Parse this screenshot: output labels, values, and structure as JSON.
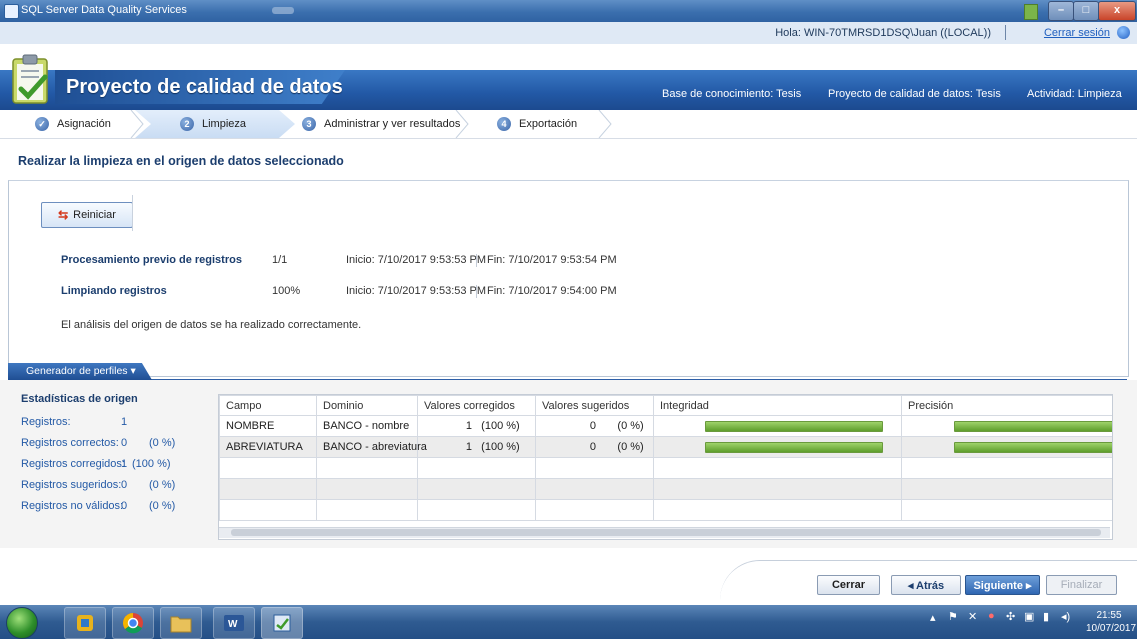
{
  "window": {
    "title": "SQL Server Data Quality Services",
    "min_glyph": "–",
    "max_glyph": "□",
    "close_glyph": "x"
  },
  "userbar": {
    "greeting": "Hola: WIN-70TMRSD1DSQ\\Juan ((LOCAL))",
    "logout": "Cerrar sesión"
  },
  "header": {
    "title": "Proyecto de calidad de datos",
    "knowledge_base": "Base de conocimiento: Tesis",
    "project": "Proyecto de calidad de datos: Tesis",
    "activity": "Actividad: Limpieza"
  },
  "steps": [
    {
      "num": "",
      "label": "Asignación"
    },
    {
      "num": "2",
      "label": "Limpieza"
    },
    {
      "num": "3",
      "label": "Administrar y ver resultados"
    },
    {
      "num": "4",
      "label": "Exportación"
    }
  ],
  "section_title": "Realizar la limpieza en el origen de datos seleccionado",
  "restart_label": "Reiniciar",
  "progress": [
    {
      "label": "Procesamiento previo de registros",
      "value": "1/1",
      "start": "Inicio: 7/10/2017 9:53:53 PM",
      "end": "Fin: 7/10/2017 9:53:54 PM"
    },
    {
      "label": "Limpiando registros",
      "value": "100%",
      "start": "Inicio: 7/10/2017 9:53:53 PM",
      "end": "Fin: 7/10/2017 9:54:00 PM"
    }
  ],
  "result_message": "El análisis del origen de datos se ha realizado correctamente.",
  "profiler_tab": "Generador de perfiles",
  "stats": {
    "title": "Estadísticas de origen",
    "rows": [
      {
        "label": "Registros:",
        "value": "1",
        "pct": ""
      },
      {
        "label": "Registros correctos:",
        "value": "0",
        "pct": "(0 %)"
      },
      {
        "label": "Registros corregidos:",
        "value": "1",
        "pct": "(100 %)"
      },
      {
        "label": "Registros sugeridos:",
        "value": "0",
        "pct": "(0 %)"
      },
      {
        "label": "Registros no válidos:",
        "value": "0",
        "pct": "(0 %)"
      }
    ]
  },
  "grid": {
    "headers": [
      "Campo",
      "Dominio",
      "Valores corregidos",
      "Valores sugeridos",
      "Integridad",
      "Precisión"
    ],
    "rows": [
      {
        "campo": "NOMBRE",
        "dominio": "BANCO - nombre",
        "corregidos": "1",
        "corregidos_pct": "(100 %)",
        "sugeridos": "0",
        "sugeridos_pct": "(0 %)",
        "integridad": 1.0,
        "precision": 1.0
      },
      {
        "campo": "ABREVIATURA",
        "dominio": "BANCO - abreviatura",
        "corregidos": "1",
        "corregidos_pct": "(100 %)",
        "sugeridos": "0",
        "sugeridos_pct": "(0 %)",
        "integridad": 1.0,
        "precision": 1.0
      }
    ]
  },
  "buttons": {
    "close": "Cerrar",
    "back": "◂ Atrás",
    "next": "Siguiente ▸",
    "finish": "Finalizar"
  },
  "taskbar": {
    "time": "21:55",
    "date": "10/07/2017"
  },
  "colors": {
    "accent": "#2258a5",
    "bar_fill": "#5e9e2c"
  }
}
